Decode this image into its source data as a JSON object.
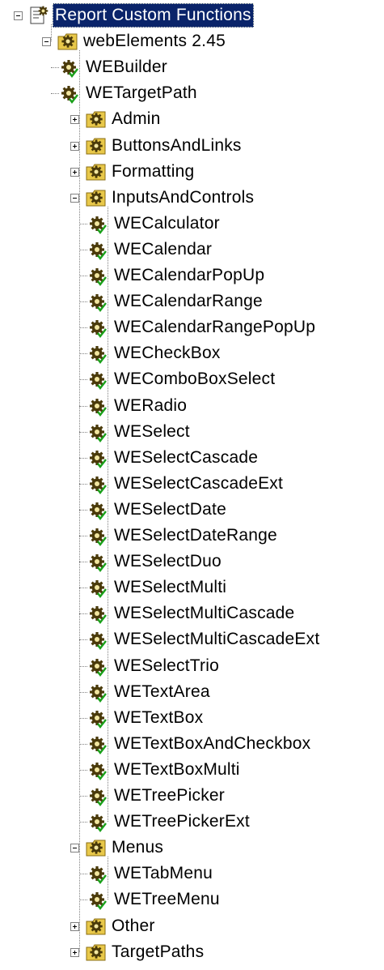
{
  "tree": {
    "root": {
      "label": "Report Custom Functions",
      "icon": "report-functions-icon",
      "expanded": true,
      "selected": true,
      "children": [
        {
          "label": "webElements 2.45",
          "icon": "folder-gear-icon",
          "expanded": true,
          "children": [
            {
              "label": "WEBuilder",
              "icon": "function-gear-icon"
            },
            {
              "label": "WETargetPath",
              "icon": "function-gear-icon"
            },
            {
              "label": "Admin",
              "icon": "folder-gear-icon",
              "expanded": false,
              "has_children": true
            },
            {
              "label": "ButtonsAndLinks",
              "icon": "folder-gear-icon",
              "expanded": false,
              "has_children": true
            },
            {
              "label": "Formatting",
              "icon": "folder-gear-icon",
              "expanded": false,
              "has_children": true
            },
            {
              "label": "InputsAndControls",
              "icon": "folder-gear-icon",
              "expanded": true,
              "children": [
                {
                  "label": "WECalculator",
                  "icon": "function-gear-icon"
                },
                {
                  "label": "WECalendar",
                  "icon": "function-gear-icon"
                },
                {
                  "label": "WECalendarPopUp",
                  "icon": "function-gear-icon"
                },
                {
                  "label": "WECalendarRange",
                  "icon": "function-gear-icon"
                },
                {
                  "label": "WECalendarRangePopUp",
                  "icon": "function-gear-icon"
                },
                {
                  "label": "WECheckBox",
                  "icon": "function-gear-icon"
                },
                {
                  "label": "WEComboBoxSelect",
                  "icon": "function-gear-icon"
                },
                {
                  "label": "WERadio",
                  "icon": "function-gear-icon"
                },
                {
                  "label": "WESelect",
                  "icon": "function-gear-icon"
                },
                {
                  "label": "WESelectCascade",
                  "icon": "function-gear-icon"
                },
                {
                  "label": "WESelectCascadeExt",
                  "icon": "function-gear-icon"
                },
                {
                  "label": "WESelectDate",
                  "icon": "function-gear-icon"
                },
                {
                  "label": "WESelectDateRange",
                  "icon": "function-gear-icon"
                },
                {
                  "label": "WESelectDuo",
                  "icon": "function-gear-icon"
                },
                {
                  "label": "WESelectMulti",
                  "icon": "function-gear-icon"
                },
                {
                  "label": "WESelectMultiCascade",
                  "icon": "function-gear-icon"
                },
                {
                  "label": "WESelectMultiCascadeExt",
                  "icon": "function-gear-icon"
                },
                {
                  "label": "WESelectTrio",
                  "icon": "function-gear-icon"
                },
                {
                  "label": "WETextArea",
                  "icon": "function-gear-icon"
                },
                {
                  "label": "WETextBox",
                  "icon": "function-gear-icon"
                },
                {
                  "label": "WETextBoxAndCheckbox",
                  "icon": "function-gear-icon"
                },
                {
                  "label": "WETextBoxMulti",
                  "icon": "function-gear-icon"
                },
                {
                  "label": "WETreePicker",
                  "icon": "function-gear-icon"
                },
                {
                  "label": "WETreePickerExt",
                  "icon": "function-gear-icon"
                }
              ]
            },
            {
              "label": "Menus",
              "icon": "folder-gear-icon",
              "expanded": true,
              "children": [
                {
                  "label": "WETabMenu",
                  "icon": "function-gear-icon"
                },
                {
                  "label": "WETreeMenu",
                  "icon": "function-gear-icon"
                }
              ]
            },
            {
              "label": "Other",
              "icon": "folder-gear-icon",
              "expanded": false,
              "has_children": true
            },
            {
              "label": "TargetPaths",
              "icon": "folder-gear-icon",
              "expanded": false,
              "has_children": true
            }
          ]
        }
      ]
    }
  },
  "colors": {
    "selection_bg": "#0a246a",
    "selection_fg": "#ffffff",
    "folder": "#e8c84a",
    "gear": "#4a3a0a",
    "check": "#1aa01a",
    "connector": "#808080"
  }
}
